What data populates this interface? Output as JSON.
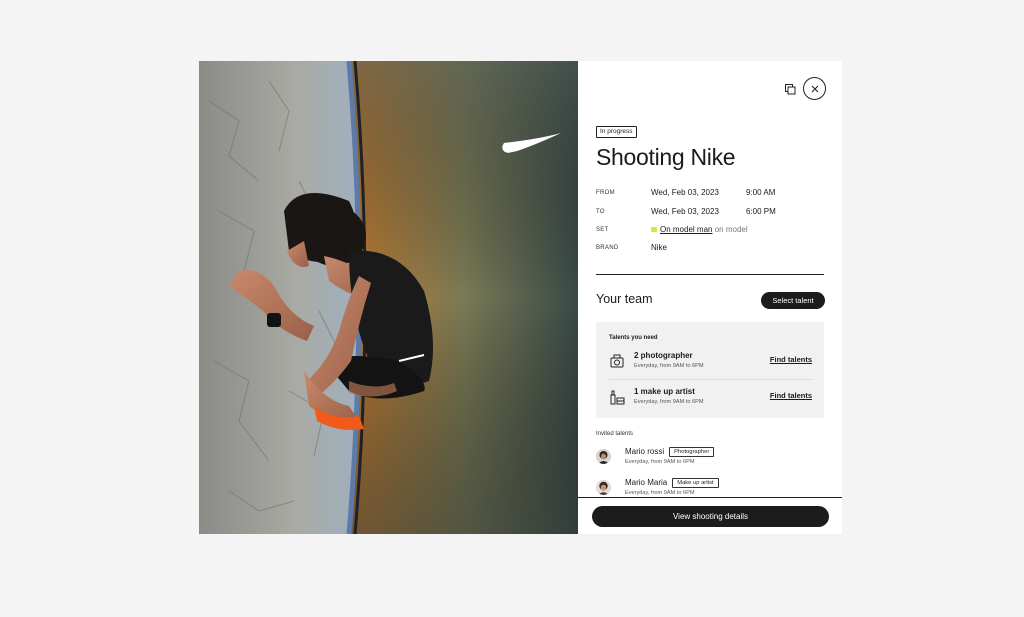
{
  "shooting": {
    "status": "In progress",
    "title": "Shooting Nike",
    "details": {
      "from_label": "FROM",
      "from_date": "Wed, Feb 03, 2023",
      "from_time": "9:00 AM",
      "to_label": "TO",
      "to_date": "Wed, Feb 03, 2023",
      "to_time": "6:00 PM",
      "set_label": "SET",
      "set_link": "On model man",
      "set_suffix": "on model",
      "brand_label": "BRAND",
      "brand_value": "Nike"
    }
  },
  "team": {
    "title": "Your team",
    "select_button": "Select talent",
    "needs_title": "Talents you need",
    "needs": [
      {
        "name": "2 photographer",
        "schedule": "Everyday, from 9AM to 6PM",
        "link": "Find talents",
        "icon": "camera-icon"
      },
      {
        "name": "1 make up artist",
        "schedule": "Everyday, from 9AM to 6PM",
        "link": "Find talents",
        "icon": "makeup-icon"
      }
    ],
    "invited_title": "Invited talents",
    "invited": [
      {
        "name": "Mario rossi",
        "role": "Photographer",
        "schedule": "Everyday, from 9AM to 6PM"
      },
      {
        "name": "Mario Maria",
        "role": "Make up artist",
        "schedule": "Everyday, from 9AM to 6PM"
      }
    ]
  },
  "footer": {
    "cta": "View shooting details"
  },
  "icons": {
    "copy": "copy-icon",
    "close": "close-icon"
  },
  "colors": {
    "accent": "#1c1c1c",
    "set_marker": "#d7e53b",
    "panel_bg": "#ffffff",
    "needs_bg": "#f1f1f1"
  }
}
